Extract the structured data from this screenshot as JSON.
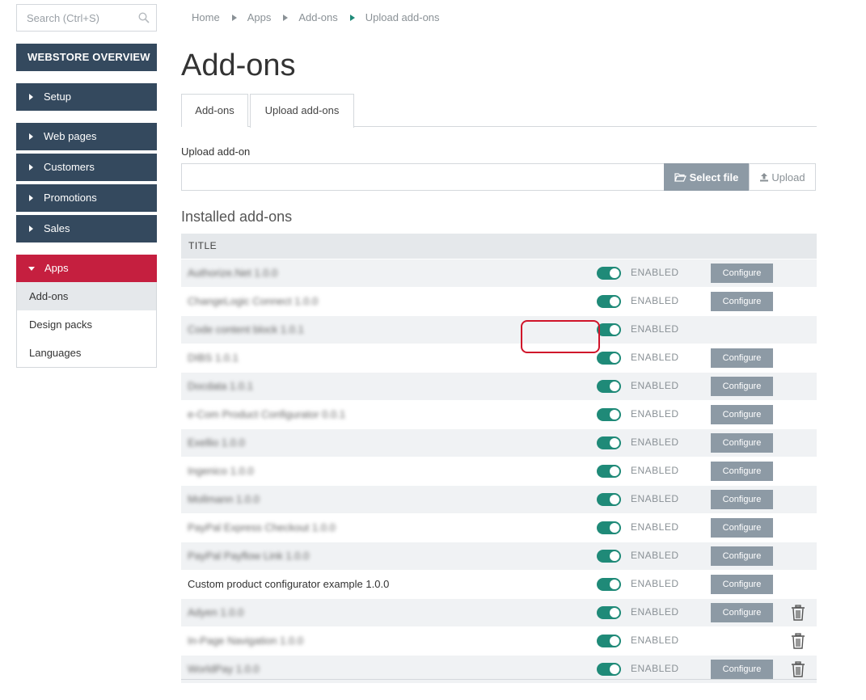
{
  "search": {
    "placeholder": "Search (Ctrl+S)",
    "icon": "search-icon"
  },
  "sidebar": {
    "overview": "WEBSTORE OVERVIEW",
    "setup": "Setup",
    "group_items": [
      "Web pages",
      "Customers",
      "Promotions",
      "Sales"
    ],
    "apps": "Apps",
    "apps_sub": [
      "Add-ons",
      "Design packs",
      "Languages"
    ],
    "active_sub": "Add-ons",
    "colors": {
      "nav": "#34495e",
      "apps": "#c51f3f"
    }
  },
  "breadcrumb": [
    "Home",
    "Apps",
    "Add-ons",
    "Upload add-ons"
  ],
  "page_title": "Add-ons",
  "tabs": [
    "Add-ons",
    "Upload add-ons"
  ],
  "active_tab": "Upload add-ons",
  "upload": {
    "label": "Upload add-on",
    "select_file": "Select file",
    "upload": "Upload"
  },
  "installed_title": "Installed add-ons",
  "table": {
    "column_title": "TITLE",
    "status_label": "ENABLED",
    "configure_label": "Configure",
    "rows": [
      {
        "title": "Authorize.Net 1.0.0",
        "blurred": true,
        "configure": true,
        "delete": false
      },
      {
        "title": "ChangeLogic Connect 1.0.0",
        "blurred": true,
        "configure": true,
        "delete": false
      },
      {
        "title": "Code content block 1.0.1",
        "blurred": true,
        "configure": false,
        "delete": false
      },
      {
        "title": "DIBS 1.0.1",
        "blurred": true,
        "configure": true,
        "delete": false
      },
      {
        "title": "Docdata 1.0.1",
        "blurred": true,
        "configure": true,
        "delete": false
      },
      {
        "title": "e-Com Product Configurator 0.0.1",
        "blurred": true,
        "configure": true,
        "delete": false
      },
      {
        "title": "Exellio 1.0.0",
        "blurred": true,
        "configure": true,
        "delete": false
      },
      {
        "title": "Ingenico 1.0.0",
        "blurred": true,
        "configure": true,
        "delete": false
      },
      {
        "title": "Mollmann 1.0.0",
        "blurred": true,
        "configure": true,
        "delete": false
      },
      {
        "title": "PayPal Express Checkout 1.0.0",
        "blurred": true,
        "configure": true,
        "delete": false
      },
      {
        "title": "PayPal Payflow Link 1.0.0",
        "blurred": true,
        "configure": true,
        "delete": false
      },
      {
        "title": "Custom product configurator example 1.0.0",
        "blurred": false,
        "configure": true,
        "delete": false,
        "highlighted": true
      },
      {
        "title": "Adyen 1.0.0",
        "blurred": true,
        "configure": true,
        "delete": true
      },
      {
        "title": "In-Page Navigation 1.0.0",
        "blurred": true,
        "configure": false,
        "delete": true
      },
      {
        "title": "WorldPay 1.0.0",
        "blurred": true,
        "configure": true,
        "delete": true
      }
    ]
  },
  "colors": {
    "toggle_on": "#1f8a78",
    "button": "#8d9aa5",
    "highlight": "#d0142a"
  }
}
